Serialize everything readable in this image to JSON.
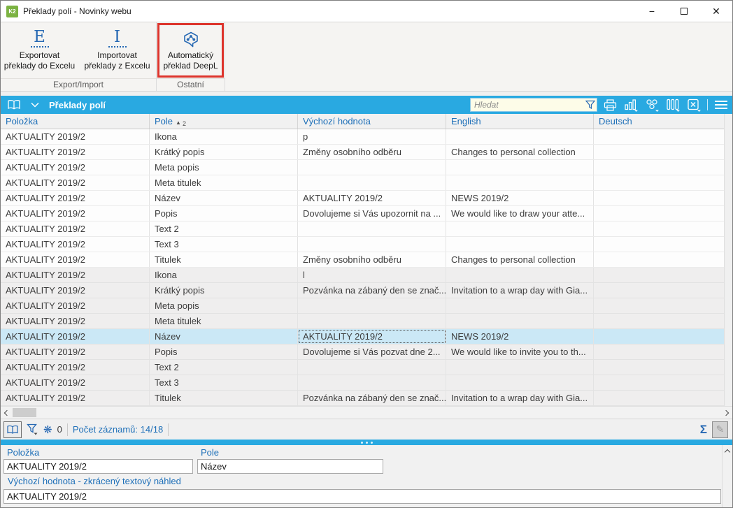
{
  "window": {
    "title": "Překlady polí - Novinky webu",
    "icon_text": "K2",
    "controls": {
      "minimize": "−",
      "close": "✕"
    }
  },
  "ribbon": {
    "buttons": [
      {
        "icon": "letter-e-icon",
        "label_line1": "Exportovat",
        "label_line2": "překlady do Excelu"
      },
      {
        "icon": "letter-i-icon",
        "label_line1": "Importovat",
        "label_line2": "překlady z Excelu"
      },
      {
        "icon": "deepl-icon",
        "label_line1": "Automatický",
        "label_line2": "překlad DeepL",
        "highlighted": true
      }
    ],
    "groups": [
      {
        "label": "Export/Import"
      },
      {
        "label": "Ostatní"
      }
    ],
    "highlight_color": "#dd342c"
  },
  "panel_header": {
    "title": "Překlady polí",
    "search_placeholder": "Hledat",
    "left_icons": [
      "open-book-icon",
      "chevron-down-icon"
    ],
    "right_icons": [
      "filter-icon",
      "print-icon",
      "chart-icon",
      "pivot-icon",
      "columns-icon",
      "excel-icon",
      "menu-icon"
    ],
    "accent_color": "#29a9e1"
  },
  "table": {
    "columns": [
      "Položka",
      "Pole",
      "Výchozí hodnota",
      "English",
      "Deutsch"
    ],
    "sort": {
      "column": "Pole",
      "direction": "asc",
      "order": "2"
    },
    "rows": [
      [
        "AKTUALITY 2019/2",
        "Ikona",
        "p",
        "",
        ""
      ],
      [
        "AKTUALITY 2019/2",
        "Krátký popis",
        "Změny osobního odběru",
        "Changes to personal collection",
        ""
      ],
      [
        "AKTUALITY 2019/2",
        "Meta popis",
        "",
        "",
        ""
      ],
      [
        "AKTUALITY 2019/2",
        "Meta titulek",
        "",
        "",
        ""
      ],
      [
        "AKTUALITY 2019/2",
        "Název",
        "AKTUALITY 2019/2",
        "NEWS 2019/2",
        ""
      ],
      [
        "AKTUALITY 2019/2",
        "Popis",
        "Dovolujeme si Vás upozornit na ...",
        "We would like to draw your atte...",
        ""
      ],
      [
        "AKTUALITY 2019/2",
        "Text 2",
        "",
        "",
        ""
      ],
      [
        "AKTUALITY 2019/2",
        "Text 3",
        "",
        "",
        ""
      ],
      [
        "AKTUALITY 2019/2",
        "Titulek",
        "Změny osobního odběru",
        "Changes to personal collection",
        ""
      ],
      [
        "AKTUALITY 2019/2",
        "Ikona",
        "l",
        "",
        ""
      ],
      [
        "AKTUALITY 2019/2",
        "Krátký popis",
        "Pozvánka na zábaný den se znač...",
        "Invitation to a wrap day with Gia...",
        ""
      ],
      [
        "AKTUALITY 2019/2",
        "Meta popis",
        "",
        "",
        ""
      ],
      [
        "AKTUALITY 2019/2",
        "Meta titulek",
        "",
        "",
        ""
      ],
      [
        "AKTUALITY 2019/2",
        "Název",
        "AKTUALITY 2019/2",
        "NEWS 2019/2",
        ""
      ],
      [
        "AKTUALITY 2019/2",
        "Popis",
        "Dovolujeme si Vás pozvat dne 2...",
        "We would like to invite you to th...",
        ""
      ],
      [
        "AKTUALITY 2019/2",
        "Text 2",
        "",
        "",
        ""
      ],
      [
        "AKTUALITY 2019/2",
        "Text 3",
        "",
        "",
        ""
      ],
      [
        "AKTUALITY 2019/2",
        "Titulek",
        "Pozvánka na zábaný den se znač...",
        "Invitation to a wrap day with Gia...",
        ""
      ]
    ],
    "selected_row": 13,
    "focused_col": 2,
    "group_break": 9,
    "selected_color": "#cbe8f6"
  },
  "status_bar": {
    "frozen_count": "0",
    "record_count": "Počet záznamů: 14/18",
    "icons": [
      "book-view-icon",
      "filter-menu-icon",
      "freeze-icon",
      "sigma-icon",
      "pencil-icon"
    ]
  },
  "detail": {
    "fields": [
      {
        "label": "Položka",
        "value": "AKTUALITY 2019/2"
      },
      {
        "label": "Pole",
        "value": "Název"
      },
      {
        "label": "Výchozí hodnota - zkrácený textový náhled",
        "value": "AKTUALITY 2019/2"
      }
    ]
  }
}
